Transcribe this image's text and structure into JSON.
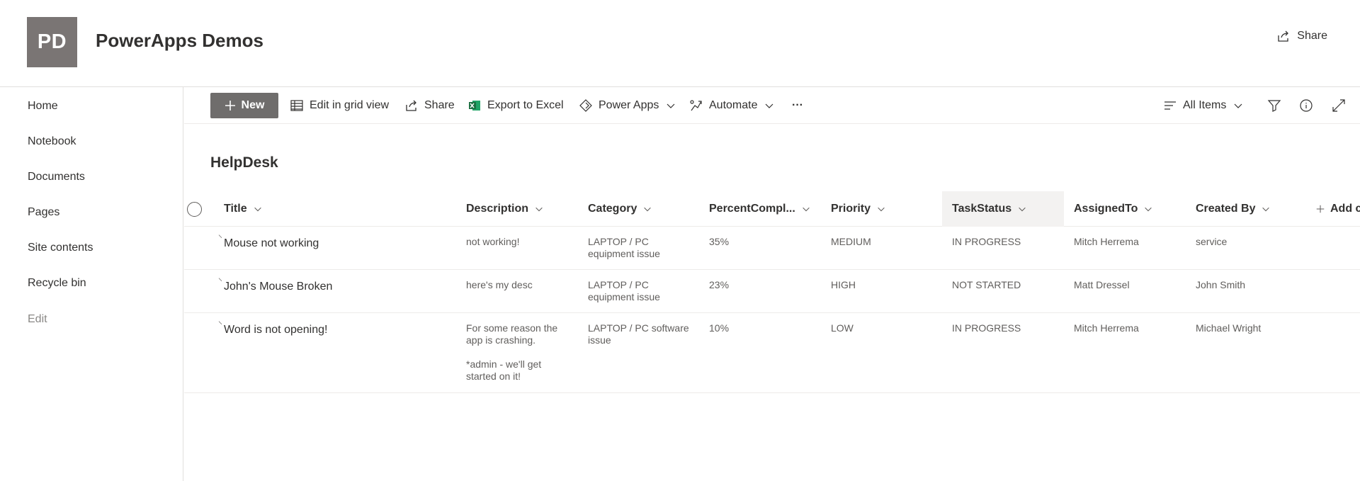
{
  "site": {
    "logo_initials": "PD",
    "title": "PowerApps Demos",
    "share_label": "Share"
  },
  "nav": {
    "items": [
      "Home",
      "Notebook",
      "Documents",
      "Pages",
      "Site contents",
      "Recycle bin"
    ],
    "edit": "Edit"
  },
  "command_bar": {
    "new": "New",
    "edit_grid": "Edit in grid view",
    "share": "Share",
    "export": "Export to Excel",
    "power_apps": "Power Apps",
    "automate": "Automate",
    "more": "···",
    "view": "All Items"
  },
  "list": {
    "title": "HelpDesk",
    "columns": [
      "Title",
      "Description",
      "Category",
      "PercentCompl...",
      "Priority",
      "TaskStatus",
      "AssignedTo",
      "Created By",
      "Add c"
    ],
    "rows": [
      {
        "title": "Mouse not working",
        "description": "not working!",
        "category": "LAPTOP / PC\nequipment issue",
        "percent": "35%",
        "priority": "MEDIUM",
        "status": "IN PROGRESS",
        "assigned": "Mitch Herrema",
        "created_by": "service"
      },
      {
        "title": "John's Mouse Broken",
        "description": "here's my desc",
        "category": "LAPTOP / PC\nequipment issue",
        "percent": "23%",
        "priority": "HIGH",
        "status": "NOT STARTED",
        "assigned": "Matt Dressel",
        "created_by": "John Smith"
      },
      {
        "title": "Word is not opening!",
        "description": "For some reason the\napp is crashing.\n\n*admin - we'll get\nstarted on it!",
        "category": "LAPTOP / PC software\nissue",
        "percent": "10%",
        "priority": "LOW",
        "status": "IN PROGRESS",
        "assigned": "Mitch Herrema",
        "created_by": "Michael Wright"
      }
    ]
  },
  "colors": {
    "logo_bg": "#7a7574",
    "new_button_bg": "#6f6d6c",
    "excel_green": "#1d6f42",
    "active_header_bg": "#f3f2f1"
  },
  "icons": [
    "share-icon",
    "plus-icon",
    "grid-icon",
    "excel-icon",
    "power-apps-icon",
    "automate-icon",
    "filter-icon",
    "info-icon",
    "expand-icon",
    "chevron-down-icon",
    "view-lines-icon"
  ]
}
